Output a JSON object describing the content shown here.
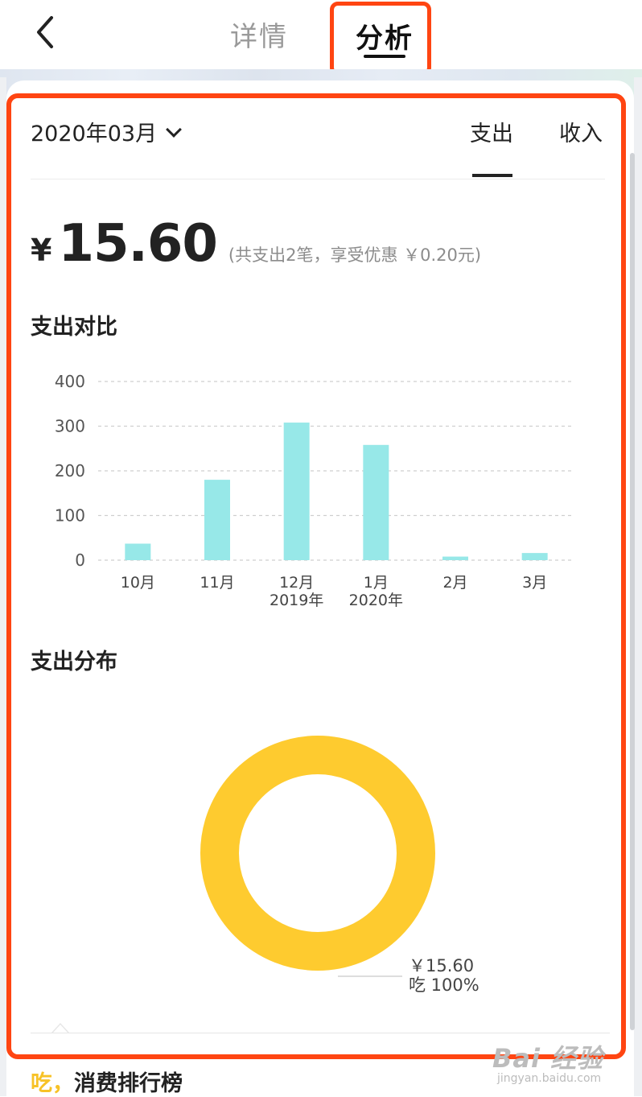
{
  "nav": {
    "back_icon": "chevron-left-icon",
    "tabs": [
      {
        "label": "详情",
        "active": false
      },
      {
        "label": "分析",
        "active": true
      }
    ],
    "highlight_color": "#ff4512"
  },
  "header": {
    "month": "2020年03月",
    "type_tabs": [
      {
        "label": "支出",
        "active": true
      },
      {
        "label": "收入",
        "active": false
      }
    ]
  },
  "summary": {
    "currency": "¥",
    "amount": "15.60",
    "note": "(共支出2笔，享受优惠 ￥0.20元)"
  },
  "sections": {
    "comparison_title": "支出对比",
    "distribution_title": "支出分布",
    "ranking_category": "吃，",
    "ranking_title": "消费排行榜"
  },
  "chart_data": [
    {
      "type": "bar",
      "title": "支出对比",
      "categories": [
        "10月",
        "11月",
        "12月\n2019年",
        "1月\n2020年",
        "2月",
        "3月"
      ],
      "values": [
        37,
        180,
        308,
        258,
        8,
        16
      ],
      "ylim": [
        0,
        400
      ],
      "yticks": [
        0,
        100,
        200,
        300,
        400
      ],
      "grid": true,
      "color": "#97e8e8"
    },
    {
      "type": "pie",
      "title": "支出分布",
      "donut": true,
      "slices": [
        {
          "label": "吃",
          "value": 15.6,
          "percent": "100%",
          "amount_label": "￥15.60",
          "pct_label": "吃 100%",
          "color": "#fecb2f"
        }
      ]
    }
  ],
  "watermark": {
    "main": "Bai 经验",
    "sub": "jingyan.baidu.com"
  }
}
